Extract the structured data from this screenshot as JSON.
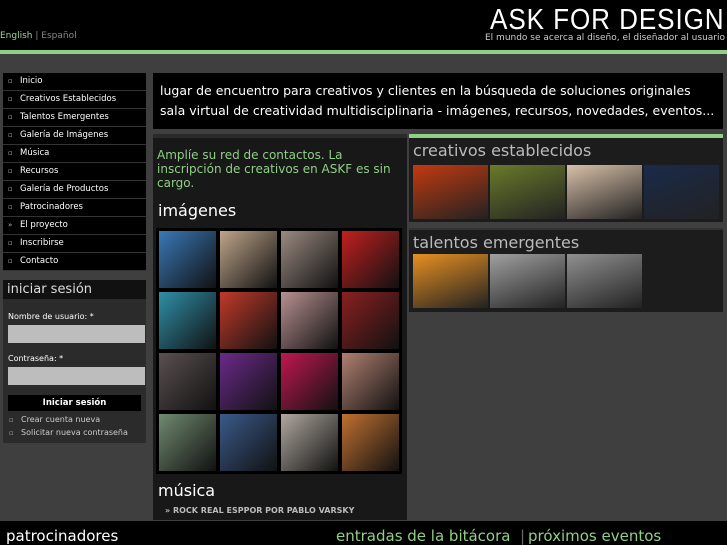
{
  "header": {
    "logo": "ASK FOR DESIGN",
    "tagline": "El mundo se acerca al diseño, el diseñador al usuario",
    "languages": [
      "English",
      "Español"
    ],
    "lang_separator": "|"
  },
  "nav": {
    "items": [
      {
        "label": "Inicio",
        "marker": "▫"
      },
      {
        "label": "Creativos Establecidos",
        "marker": "▫"
      },
      {
        "label": "Talentos Emergentes",
        "marker": "▫"
      },
      {
        "label": "Galería de Imágenes",
        "marker": "▫"
      },
      {
        "label": "Música",
        "marker": "▫"
      },
      {
        "label": "Recursos",
        "marker": "▫"
      },
      {
        "label": "Galería de Productos",
        "marker": "▫"
      },
      {
        "label": "Patrocinadores",
        "marker": "▫"
      },
      {
        "label": "El proyecto",
        "marker": "»"
      },
      {
        "label": "Inscribirse",
        "marker": "▫"
      },
      {
        "label": "Contacto",
        "marker": "▫"
      }
    ]
  },
  "login": {
    "title": "iniciar sesión",
    "username_label": "Nombre de usuario: *",
    "password_label": "Contraseña: *",
    "submit_label": "Iniciar sesión",
    "links": [
      "Crear cuenta nueva",
      "Solicitar nueva contraseña"
    ]
  },
  "intro": {
    "line1": "lugar de encuentro para creativos y clientes en la búsqueda de soluciones originales",
    "line2": "sala virtual de creatividad multidisciplinaria - imágenes, recursos, novedades, eventos..."
  },
  "contacts_text": "Amplíe su red de contactos. La inscripción de creativos en ASKF es sin cargo.",
  "images_section": {
    "title": "imágenes",
    "thumbs": [
      "#3a78b8",
      "#bfa58a",
      "#9a8a80",
      "#c02020",
      "#2f8fa8",
      "#c03a2a",
      "#b89090",
      "#8a2020",
      "#5a5050",
      "#6a2a8a",
      "#c01850",
      "#b08070",
      "#708a70",
      "#3a5a8a",
      "#b0a8a0",
      "#c07030"
    ]
  },
  "music_section": {
    "title": "música",
    "item": "ROCK REAL ESPPOR POR PABLO VARSKY",
    "item_marker": "»"
  },
  "established": {
    "title": "creativos establecidos",
    "thumbs": [
      "#c23a10",
      "#6a7a2a",
      "#d8c0a8",
      "#1a2a4a"
    ]
  },
  "emerging": {
    "title": "talentos emergentes",
    "thumbs": [
      "#e89020",
      "#a0a0a0",
      "#909090"
    ]
  },
  "footer": {
    "sponsors": "patrocinadores",
    "blog": "entradas de la bitácora",
    "events": "próximos eventos"
  },
  "colors": {
    "accent": "#8fcf86",
    "background": "#3f3f3f",
    "panel": "#000000"
  }
}
